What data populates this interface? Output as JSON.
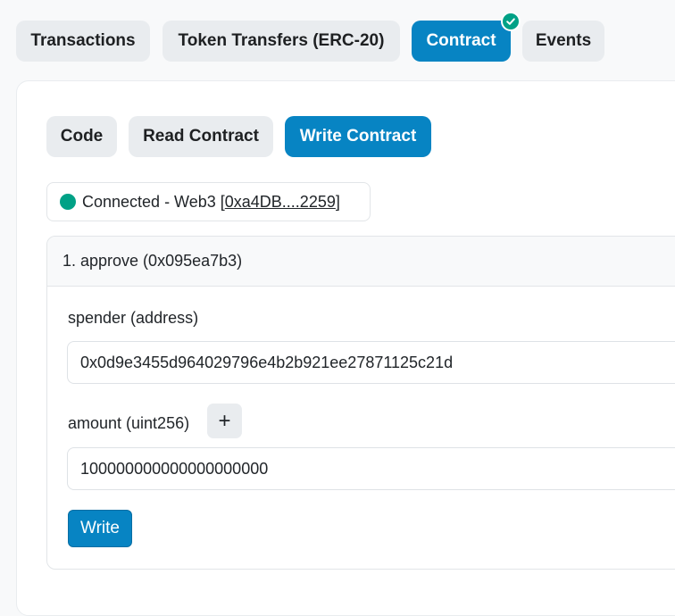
{
  "tabs": [
    {
      "label": "Transactions",
      "active": false
    },
    {
      "label": "Token Transfers (ERC-20)",
      "active": false
    },
    {
      "label": "Contract",
      "active": true,
      "verified": true
    },
    {
      "label": "Events",
      "active": false
    }
  ],
  "subtabs": [
    {
      "label": "Code",
      "active": false
    },
    {
      "label": "Read Contract",
      "active": false
    },
    {
      "label": "Write Contract",
      "active": true
    }
  ],
  "connection": {
    "status_text": "Connected - Web3 [",
    "address": "0xa4DB....2259",
    "close": "]",
    "dot_color": "#00a186"
  },
  "function": {
    "title": "1. approve (0x095ea7b3)",
    "params": [
      {
        "label": "spender (address)",
        "value": "0x0d9e3455d964029796e4b2b921ee27871125c21d"
      },
      {
        "label": "amount (uint256)",
        "value": "100000000000000000000"
      }
    ],
    "plus_label": "+",
    "write_label": "Write"
  },
  "colors": {
    "accent": "#0784c3",
    "success": "#00a186"
  }
}
